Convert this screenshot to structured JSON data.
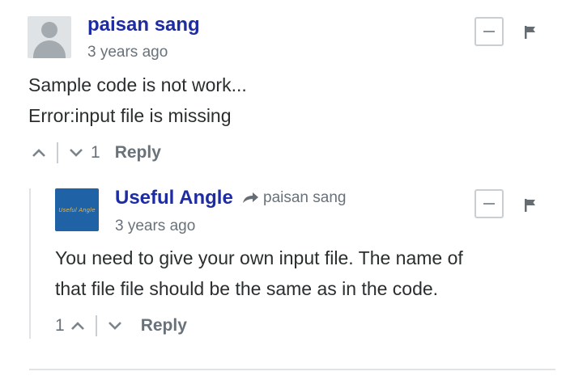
{
  "comments": [
    {
      "author": "paisan sang",
      "timestamp": "3 years ago",
      "message_lines": [
        "Sample code is not work...",
        "Error:input file is missing"
      ],
      "upvotes": "",
      "downvotes": "1",
      "reply_label": "Reply"
    },
    {
      "author": "Useful Angle",
      "avatar_text": "Useful Angle",
      "in_reply_to": "paisan sang",
      "timestamp": "3 years ago",
      "message_lines": [
        "You need to give your own input file. The name of",
        "that file file should be the same as in the code."
      ],
      "upvotes": "1",
      "downvotes": "",
      "reply_label": "Reply"
    }
  ],
  "colors": {
    "author": "#1e2ca3",
    "muted": "#69727a",
    "text": "#2a2e2e"
  },
  "icons": [
    "collapse-icon",
    "flag-icon",
    "upvote-icon",
    "downvote-icon",
    "reply-arrow-icon"
  ]
}
